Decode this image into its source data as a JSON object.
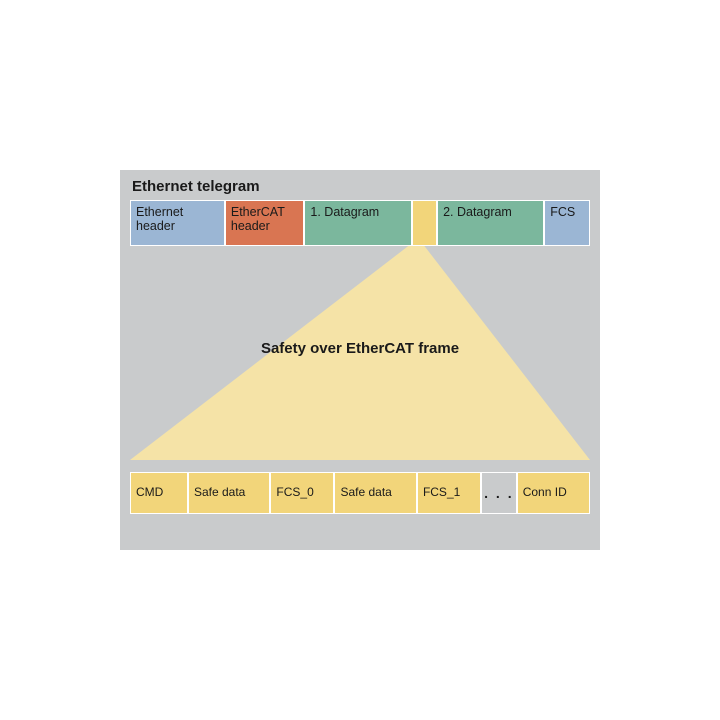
{
  "title_top": "Ethernet telegram",
  "top_row": [
    {
      "label": "Ethernet header",
      "color": "blue",
      "flex": 1.35
    },
    {
      "label": "EtherCAT header",
      "color": "orange",
      "flex": 1.1
    },
    {
      "label": "1. Datagram",
      "color": "green",
      "flex": 1.55
    },
    {
      "label": "",
      "color": "yellow",
      "flex": 0.22
    },
    {
      "label": "2. Datagram",
      "color": "green",
      "flex": 1.55
    },
    {
      "label": "FCS",
      "color": "blue",
      "flex": 0.55
    }
  ],
  "mid_label": "Safety over EtherCAT frame",
  "bottom_row": [
    {
      "label": "CMD",
      "color": "yellow",
      "flex": 0.75
    },
    {
      "label": "Safe data",
      "color": "yellow",
      "flex": 1.15
    },
    {
      "label": "FCS_0",
      "color": "yellow",
      "flex": 0.85
    },
    {
      "label": "Safe data",
      "color": "yellow",
      "flex": 1.15
    },
    {
      "label": "FCS_1",
      "color": "yellow",
      "flex": 0.85
    },
    {
      "label": ". . .",
      "color": "dots",
      "flex": 0.55
    },
    {
      "label": "Conn ID",
      "color": "yellow",
      "flex": 1.0
    }
  ],
  "triangle_color": "#f5e3a7",
  "triangle_apex_left": 0.605,
  "triangle_apex_right": 0.64
}
